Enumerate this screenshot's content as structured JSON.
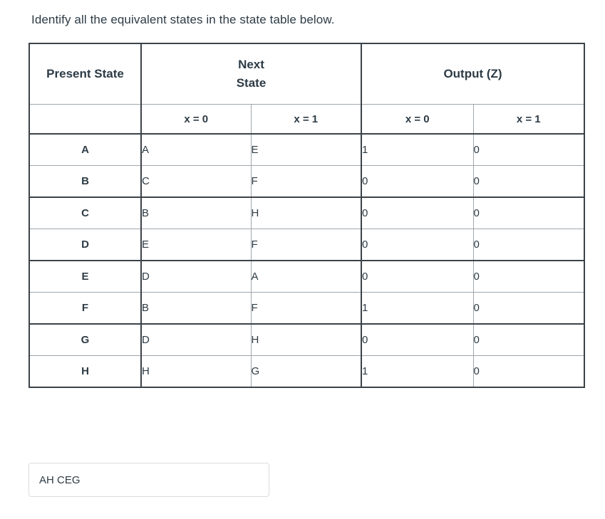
{
  "question": {
    "prompt": "Identify all the equivalent states in the state table below."
  },
  "table": {
    "headers": {
      "present_state": "Present State",
      "next_state": "Next\nState",
      "next_state_line1": "Next",
      "next_state_line2": "State",
      "output": "Output (Z)"
    },
    "subheaders": {
      "present_blank": "",
      "next_x0": "x = 0",
      "next_x1": "x = 1",
      "out_x0": "x = 0",
      "out_x1": "x = 1"
    },
    "columns": [
      "Present State",
      "Next State x = 0",
      "Next State x = 1",
      "Output (Z) x = 0",
      "Output (Z) x = 1"
    ],
    "rows": [
      {
        "present": "A",
        "next_x0": "A",
        "next_x1": "E",
        "out_x0": "1",
        "out_x1": "0"
      },
      {
        "present": "B",
        "next_x0": "C",
        "next_x1": "F",
        "out_x0": "0",
        "out_x1": "0"
      },
      {
        "present": "C",
        "next_x0": "B",
        "next_x1": "H",
        "out_x0": "0",
        "out_x1": "0"
      },
      {
        "present": "D",
        "next_x0": "E",
        "next_x1": "F",
        "out_x0": "0",
        "out_x1": "0"
      },
      {
        "present": "E",
        "next_x0": "D",
        "next_x1": "A",
        "out_x0": "0",
        "out_x1": "0"
      },
      {
        "present": "F",
        "next_x0": "B",
        "next_x1": "F",
        "out_x0": "1",
        "out_x1": "0"
      },
      {
        "present": "G",
        "next_x0": "D",
        "next_x1": "H",
        "out_x0": "0",
        "out_x1": "0"
      },
      {
        "present": "H",
        "next_x0": "H",
        "next_x1": "G",
        "out_x0": "1",
        "out_x1": "0"
      }
    ]
  },
  "answer": {
    "value": "AH CEG",
    "placeholder": ""
  },
  "colors": {
    "text": "#2d3b45",
    "border_strong": "#3b4349",
    "border_light": "#b9c0c5",
    "input_border": "#d9dcde",
    "background": "#ffffff"
  }
}
